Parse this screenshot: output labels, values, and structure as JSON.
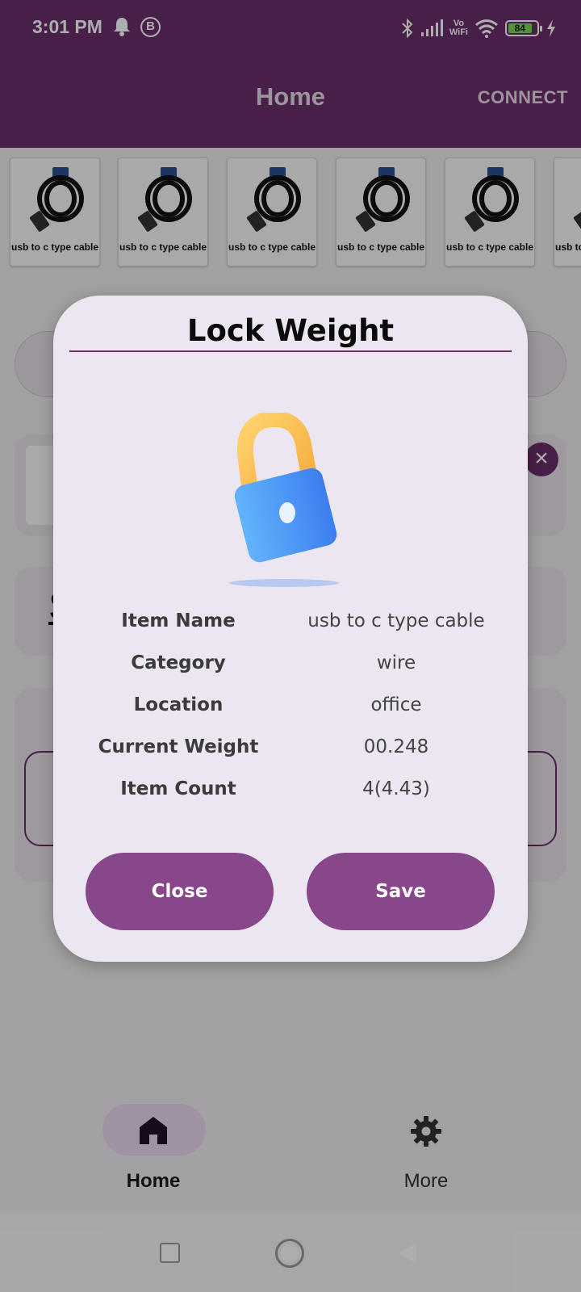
{
  "status_bar": {
    "time": "3:01 PM",
    "notification_icons": [
      "bell-icon",
      "b-app-icon"
    ],
    "b_app_letter": "B",
    "vowifi_top": "Vo",
    "vowifi_bottom": "WiFi",
    "battery_level": "84"
  },
  "app_bar": {
    "title": "Home",
    "connect_label": "CONNECT"
  },
  "items": [
    {
      "name": "usb to c type cable"
    },
    {
      "name": "usb to c type cable"
    },
    {
      "name": "usb to c type cable"
    },
    {
      "name": "usb to c type cable"
    },
    {
      "name": "usb to c type cable"
    },
    {
      "name": "usb to c type cable"
    }
  ],
  "dialog": {
    "title": "Lock Weight",
    "icon": "lock-icon",
    "fields": [
      {
        "label": "Item Name",
        "value": "usb to c type cable"
      },
      {
        "label": "Category",
        "value": "wire"
      },
      {
        "label": "Location",
        "value": "office"
      },
      {
        "label": "Current Weight",
        "value": "00.248"
      },
      {
        "label": "Item Count",
        "value": "4(4.43)"
      }
    ],
    "close_label": "Close",
    "save_label": "Save"
  },
  "bottom_nav": {
    "items": [
      {
        "label": "Home",
        "icon": "home-icon",
        "active": true
      },
      {
        "label": "More",
        "icon": "gear-icon",
        "active": false
      }
    ]
  },
  "colors": {
    "primary": "#6a2e6b",
    "button": "#88468b",
    "dialog_bg": "#ece6f0"
  }
}
